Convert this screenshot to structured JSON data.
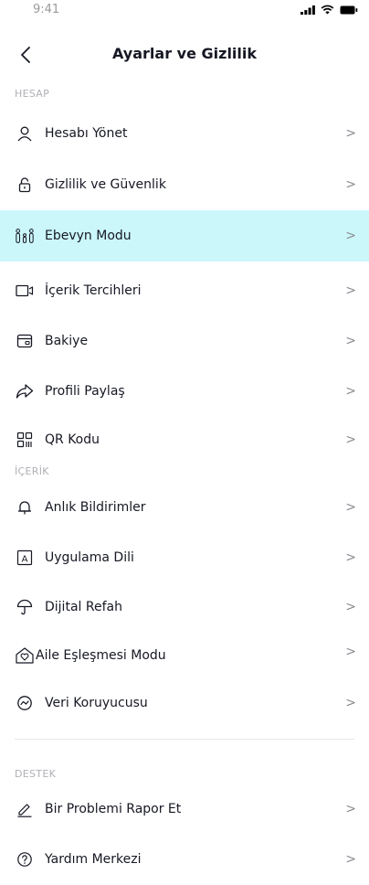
{
  "status": {
    "time": "9:41"
  },
  "header": {
    "title": "Ayarlar ve Gizlilik"
  },
  "sections": {
    "account": "HESAP",
    "content": "İÇERİK",
    "support": "DESTEK"
  },
  "items": {
    "manage_account": "Hesabı Yönet",
    "privacy": "Gizlilik ve Güvenlik",
    "parent_mode": "Ebevyn Modu",
    "content_prefs": "İçerik Tercihleri",
    "balance": "Bakiye",
    "share_profile": "Profili Paylaş",
    "qr_code": "QR Kodu",
    "push_notifications": "Anlık Bildirimler",
    "app_language": "Uygulama Dili",
    "digital_wellbeing": "Dijital Refah",
    "family_pairing": "Aile Eşleşmesi Modu",
    "data_saver": "Veri Koruyucusu",
    "report_problem": "Bir Problemi Rapor Et",
    "help_center": "Yardım Merkezi"
  },
  "chevron": ">",
  "colors": {
    "highlight": "#cbf7fb",
    "text": "#161823",
    "muted": "#b0b0b6",
    "chevron": "#8a8b91"
  }
}
